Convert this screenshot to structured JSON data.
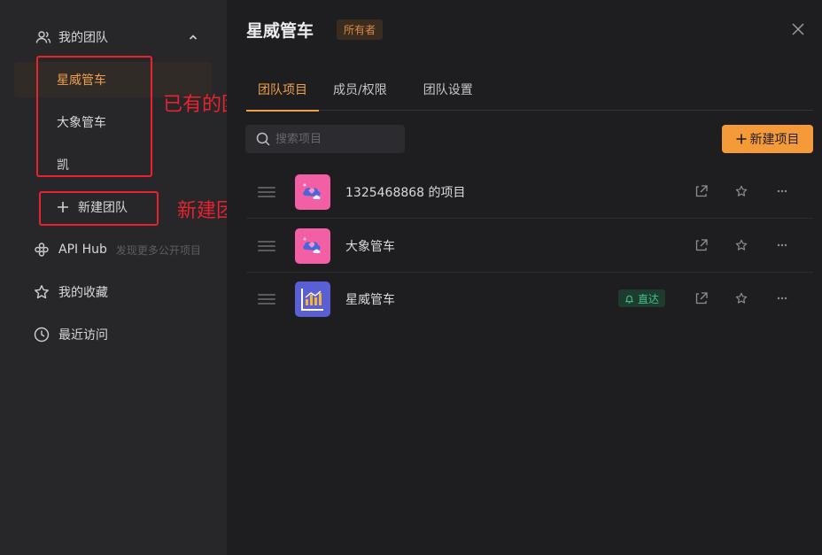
{
  "sidebar": {
    "team_header": "我的团队",
    "teams": [
      {
        "name": "星威管车",
        "active": true
      },
      {
        "name": "大象管车",
        "active": false
      },
      {
        "name": "凯",
        "active": false
      }
    ],
    "new_team": "新建团队",
    "nav": [
      {
        "label": "API Hub",
        "hint": "发现更多公开项目",
        "icon": "api-hub-icon"
      },
      {
        "label": "我的收藏",
        "hint": "",
        "icon": "star-icon"
      },
      {
        "label": "最近访问",
        "hint": "",
        "icon": "clock-icon"
      }
    ]
  },
  "annotations": {
    "existing_teams": "已有的团队",
    "new_team": "新建团队",
    "color": "#e8222e"
  },
  "main": {
    "title": "星威管车",
    "owner_badge": "所有者",
    "tabs": [
      "团队项目",
      "成员/权限",
      "团队设置"
    ],
    "active_tab": 0,
    "search_placeholder": "搜索项目",
    "new_project": "新建项目",
    "projects": [
      {
        "name": "1325468868 的项目",
        "avatar": "cloud-heart",
        "badge": ""
      },
      {
        "name": "大象管车",
        "avatar": "cloud-heart",
        "badge": ""
      },
      {
        "name": "星威管车",
        "avatar": "chart",
        "badge": "直达"
      }
    ]
  },
  "colors": {
    "accent": "#f59a38",
    "env_badge": "#3fc28b"
  }
}
